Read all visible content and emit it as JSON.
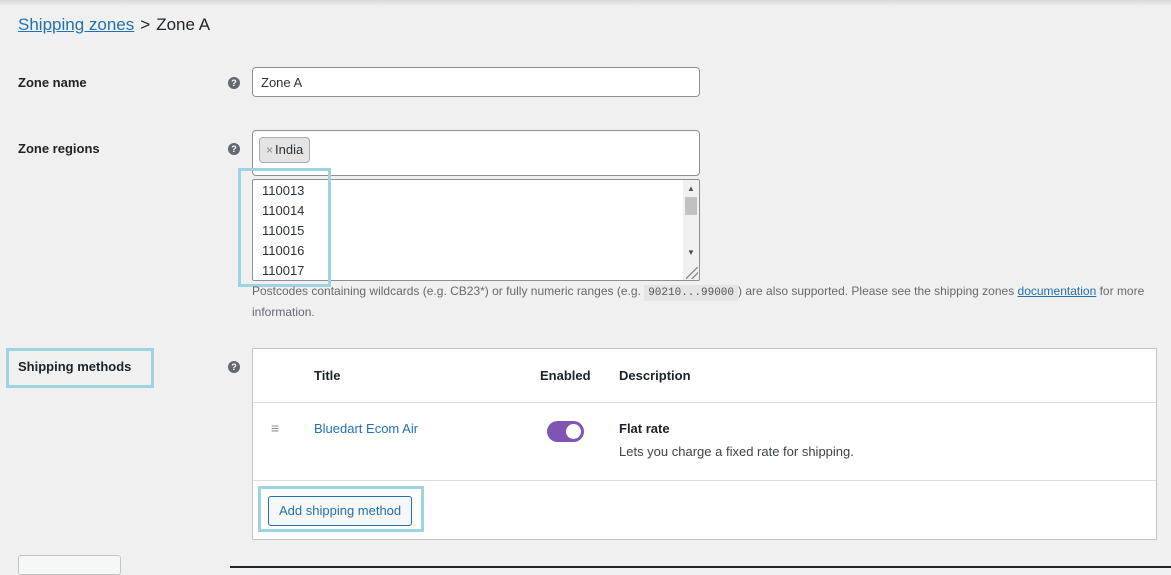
{
  "breadcrumb": {
    "parent_label": "Shipping zones",
    "separator": ">",
    "current": "Zone A"
  },
  "zone_name": {
    "label": "Zone name",
    "value": "Zone A",
    "help_icon": "question-circle-icon"
  },
  "zone_regions": {
    "label": "Zone regions",
    "help_icon": "question-circle-icon",
    "selected": [
      {
        "remove": "×",
        "label": "India"
      }
    ],
    "postcodes": [
      "110013",
      "110014",
      "110015",
      "110016",
      "110017"
    ],
    "description_before": "Postcodes containing wildcards (e.g. CB23*) or fully numeric ranges (e.g. ",
    "description_code": "90210...99000",
    "description_middle": ") are also supported. Please see the shipping zones ",
    "description_link": "documentation",
    "description_after": " for more information."
  },
  "shipping_methods": {
    "label": "Shipping methods",
    "help_icon": "question-circle-icon",
    "columns": {
      "title": "Title",
      "enabled": "Enabled",
      "description": "Description"
    },
    "rows": [
      {
        "title": "Bluedart Ecom Air",
        "enabled": true,
        "method_type": "Flat rate",
        "description": "Lets you charge a fixed rate for shipping."
      }
    ],
    "add_button_label": "Add shipping method"
  },
  "colors": {
    "link": "#2271b1",
    "toggle_on": "#7f54b3",
    "highlight": "#9fd3e2",
    "background": "#f0f0f1"
  }
}
